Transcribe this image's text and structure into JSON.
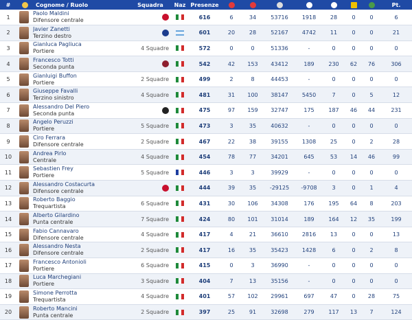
{
  "header": {
    "rank": "#",
    "player": "Cognome / Ruolo",
    "squadra": "Squadra",
    "naz": "Naz",
    "presenze": "Presenze",
    "pt": "Pt.",
    "icons": [
      "shirt-icon",
      "red-arrow-icon",
      "red-arrow-icon",
      "clock-icon",
      "ball-icon",
      "ball-icon",
      "yellow-card-icon",
      "red-card-icon",
      "stats-icon"
    ]
  },
  "colors": {
    "header_bg": "#1f4aa5",
    "row_alt": "#eef2f8",
    "link": "#1f3f7a"
  },
  "rows": [
    {
      "rank": "1",
      "name": "Paolo Maldini",
      "role": "Difensore centrale",
      "squadre": "",
      "club": "milan",
      "flag": "it",
      "presenze": "616",
      "c1": "6",
      "c2": "34",
      "c3": "53716",
      "c4": "1918",
      "c5": "28",
      "c6": "0",
      "c7": "0",
      "pt": "6"
    },
    {
      "rank": "2",
      "name": "Javier Zanetti",
      "role": "Terzino destro",
      "squadre": "",
      "club": "inter",
      "flag": "ar",
      "presenze": "601",
      "c1": "20",
      "c2": "28",
      "c3": "52167",
      "c4": "4742",
      "c5": "11",
      "c6": "0",
      "c7": "0",
      "pt": "21"
    },
    {
      "rank": "3",
      "name": "Gianluca Pagliuca",
      "role": "Portiere",
      "squadre": "4 Squadre",
      "club": "",
      "flag": "it",
      "presenze": "572",
      "c1": "0",
      "c2": "0",
      "c3": "51336",
      "c4": "-",
      "c5": "0",
      "c6": "0",
      "c7": "0",
      "pt": "0"
    },
    {
      "rank": "4",
      "name": "Francesco Totti",
      "role": "Seconda punta",
      "squadre": "",
      "club": "roma",
      "flag": "it",
      "presenze": "542",
      "c1": "42",
      "c2": "153",
      "c3": "43412",
      "c4": "189",
      "c5": "230",
      "c6": "62",
      "c7": "76",
      "pt": "306"
    },
    {
      "rank": "5",
      "name": "Gianluigi Buffon",
      "role": "Portiere",
      "squadre": "2 Squadre",
      "club": "",
      "flag": "it",
      "presenze": "499",
      "c1": "2",
      "c2": "8",
      "c3": "44453",
      "c4": "-",
      "c5": "0",
      "c6": "0",
      "c7": "0",
      "pt": "0"
    },
    {
      "rank": "6",
      "name": "Giuseppe Favalli",
      "role": "Terzino sinistro",
      "squadre": "4 Squadre",
      "club": "",
      "flag": "it",
      "presenze": "481",
      "c1": "31",
      "c2": "100",
      "c3": "38147",
      "c4": "5450",
      "c5": "7",
      "c6": "0",
      "c7": "5",
      "pt": "12"
    },
    {
      "rank": "7",
      "name": "Alessandro Del Piero",
      "role": "Seconda punta",
      "squadre": "",
      "club": "juve",
      "flag": "it",
      "presenze": "475",
      "c1": "97",
      "c2": "159",
      "c3": "32747",
      "c4": "175",
      "c5": "187",
      "c6": "46",
      "c7": "44",
      "pt": "231"
    },
    {
      "rank": "8",
      "name": "Angelo Peruzzi",
      "role": "Portiere",
      "squadre": "5 Squadre",
      "club": "",
      "flag": "it",
      "presenze": "473",
      "c1": "3",
      "c2": "35",
      "c3": "40632",
      "c4": "-",
      "c5": "0",
      "c6": "0",
      "c7": "0",
      "pt": "0"
    },
    {
      "rank": "9",
      "name": "Ciro Ferrara",
      "role": "Difensore centrale",
      "squadre": "2 Squadre",
      "club": "",
      "flag": "it",
      "presenze": "467",
      "c1": "22",
      "c2": "38",
      "c3": "39155",
      "c4": "1308",
      "c5": "25",
      "c6": "0",
      "c7": "2",
      "pt": "28"
    },
    {
      "rank": "10",
      "name": "Andrea Pirlo",
      "role": "Centrale",
      "squadre": "4 Squadre",
      "club": "",
      "flag": "it",
      "presenze": "454",
      "c1": "78",
      "c2": "77",
      "c3": "34201",
      "c4": "645",
      "c5": "53",
      "c6": "14",
      "c7": "46",
      "pt": "99"
    },
    {
      "rank": "11",
      "name": "Sebastien Frey",
      "role": "Portiere",
      "squadre": "5 Squadre",
      "club": "",
      "flag": "fr",
      "presenze": "446",
      "c1": "3",
      "c2": "3",
      "c3": "39929",
      "c4": "-",
      "c5": "0",
      "c6": "0",
      "c7": "0",
      "pt": "0"
    },
    {
      "rank": "12",
      "name": "Alessandro Costacurta",
      "role": "Difensore centrale",
      "squadre": "",
      "club": "milan",
      "flag": "it",
      "presenze": "444",
      "c1": "39",
      "c2": "35",
      "c3": "-29125",
      "c4": "-9708",
      "c5": "3",
      "c6": "0",
      "c7": "1",
      "pt": "4"
    },
    {
      "rank": "13",
      "name": "Roberto Baggio",
      "role": "Trequartista",
      "squadre": "6 Squadre",
      "club": "",
      "flag": "it",
      "presenze": "431",
      "c1": "30",
      "c2": "106",
      "c3": "34308",
      "c4": "176",
      "c5": "195",
      "c6": "64",
      "c7": "8",
      "pt": "203"
    },
    {
      "rank": "14",
      "name": "Alberto Gilardino",
      "role": "Punta centrale",
      "squadre": "7 Squadre",
      "club": "",
      "flag": "it",
      "presenze": "424",
      "c1": "80",
      "c2": "101",
      "c3": "31014",
      "c4": "189",
      "c5": "164",
      "c6": "12",
      "c7": "35",
      "pt": "199"
    },
    {
      "rank": "15",
      "name": "Fabio Cannavaro",
      "role": "Difensore centrale",
      "squadre": "4 Squadre",
      "club": "",
      "flag": "it",
      "presenze": "417",
      "c1": "4",
      "c2": "21",
      "c3": "36610",
      "c4": "2816",
      "c5": "13",
      "c6": "0",
      "c7": "0",
      "pt": "13"
    },
    {
      "rank": "16",
      "name": "Alessandro Nesta",
      "role": "Difensore centrale",
      "squadre": "2 Squadre",
      "club": "",
      "flag": "it",
      "presenze": "417",
      "c1": "16",
      "c2": "35",
      "c3": "35423",
      "c4": "1428",
      "c5": "6",
      "c6": "0",
      "c7": "2",
      "pt": "8"
    },
    {
      "rank": "17",
      "name": "Francesco Antonioli",
      "role": "Portiere",
      "squadre": "6 Squadre",
      "club": "",
      "flag": "it",
      "presenze": "415",
      "c1": "0",
      "c2": "3",
      "c3": "36990",
      "c4": "-",
      "c5": "0",
      "c6": "0",
      "c7": "0",
      "pt": "0"
    },
    {
      "rank": "18",
      "name": "Luca Marchegiani",
      "role": "Portiere",
      "squadre": "3 Squadre",
      "club": "",
      "flag": "it",
      "presenze": "404",
      "c1": "7",
      "c2": "13",
      "c3": "35156",
      "c4": "-",
      "c5": "0",
      "c6": "0",
      "c7": "0",
      "pt": "0"
    },
    {
      "rank": "19",
      "name": "Simone Perrotta",
      "role": "Trequartista",
      "squadre": "4 Squadre",
      "club": "",
      "flag": "it",
      "presenze": "401",
      "c1": "57",
      "c2": "102",
      "c3": "29961",
      "c4": "697",
      "c5": "47",
      "c6": "0",
      "c7": "28",
      "pt": "75"
    },
    {
      "rank": "20",
      "name": "Roberto Mancini",
      "role": "Punta centrale",
      "squadre": "2 Squadre",
      "club": "",
      "flag": "it",
      "presenze": "397",
      "c1": "25",
      "c2": "91",
      "c3": "32698",
      "c4": "279",
      "c5": "117",
      "c6": "13",
      "c7": "7",
      "pt": "124"
    }
  ]
}
